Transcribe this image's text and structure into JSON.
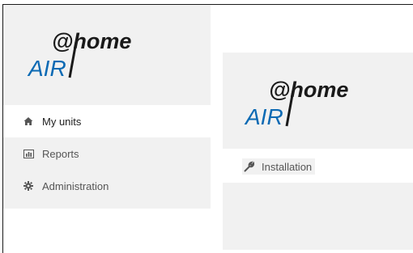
{
  "brand": {
    "logo_text_top": "@home",
    "logo_text_bottom": "AIR",
    "logo_color": "#0c6ab4",
    "logo_text_color": "#1a1a1a"
  },
  "sidebar": {
    "items": [
      {
        "label": "My units",
        "icon": "home-icon",
        "active": true
      },
      {
        "label": "Reports",
        "icon": "chart-icon",
        "active": false
      },
      {
        "label": "Administration",
        "icon": "gear-icon",
        "active": false
      }
    ]
  },
  "main": {
    "install_label": "Installation",
    "install_icon": "wrench-icon"
  },
  "colors": {
    "panel_bg": "#f1f1f1",
    "text": "#555555"
  }
}
